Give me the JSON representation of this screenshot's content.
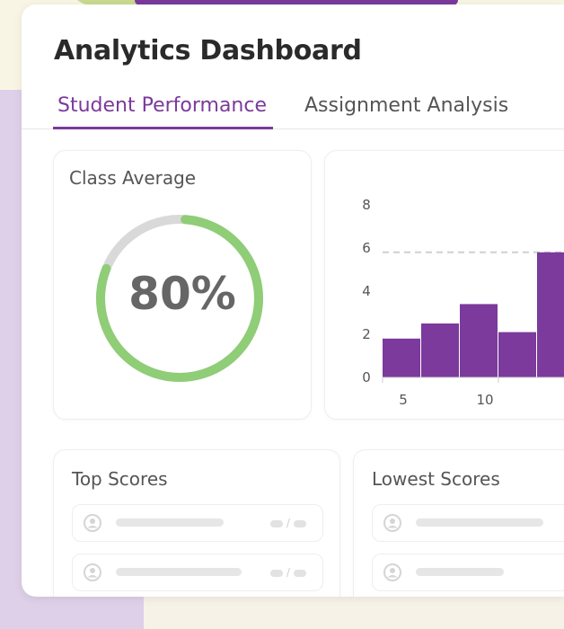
{
  "header": {
    "title": "Analytics Dashboard"
  },
  "tabs": [
    {
      "label": "Student Performance",
      "active": true
    },
    {
      "label": "Assignment Analysis",
      "active": false
    }
  ],
  "class_average": {
    "title": "Class Average",
    "value_text": "80%",
    "progress": 0.8,
    "colors": {
      "fill": "#8fcd77",
      "track": "#d9d9d9"
    }
  },
  "histogram": {
    "y_ticks": [
      "0",
      "2",
      "4",
      "6",
      "8"
    ],
    "x_ticks": [
      "5",
      "10"
    ],
    "colors": {
      "bar": "#7b3a9c",
      "reference_line": "#d0d0d0"
    }
  },
  "chart_data": {
    "type": "bar",
    "x_ticks": [
      5,
      10
    ],
    "values": [
      1.8,
      2.5,
      3.4,
      2.1,
      5.8
    ],
    "ylim": [
      0,
      8
    ],
    "reference_line": 5.8,
    "title": "",
    "xlabel": "",
    "ylabel": ""
  },
  "top_scores": {
    "title": "Top Scores",
    "separator": "/"
  },
  "lowest_scores": {
    "title": "Lowest Scores"
  },
  "icons": {
    "avatar": "user-avatar-icon"
  }
}
